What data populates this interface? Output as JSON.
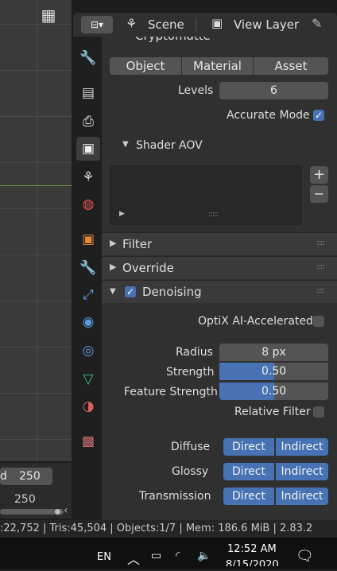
{
  "viewport": {
    "grid_icon": "grid-icon"
  },
  "timeline": {
    "frame_label": "d",
    "frame_value": "250",
    "ruler_value": "250"
  },
  "header": {
    "scene_label": "Scene",
    "view_layer_label": "View Layer"
  },
  "cryptomatte": {
    "title": "Cryptomatte",
    "buttons": [
      "Object",
      "Material",
      "Asset"
    ],
    "levels_label": "Levels",
    "levels_value": "6",
    "accurate_label": "Accurate Mode",
    "accurate_checked": true
  },
  "shader_aov": {
    "title": "Shader AOV",
    "add": "+",
    "remove": "−"
  },
  "panels": {
    "filter": "Filter",
    "override": "Override",
    "denoising": "Denoising"
  },
  "denoising": {
    "enabled": true,
    "optix_label": "OptiX AI-Accelerated",
    "radius_label": "Radius",
    "radius_value": "8 px",
    "strength_label": "Strength",
    "strength_value": "0.50",
    "strength_fraction": 0.5,
    "feature_label": "Feature Strength",
    "feature_value": "0.50",
    "feature_fraction": 0.5,
    "relative_label": "Relative Filter",
    "rows": [
      {
        "label": "Diffuse",
        "direct": "Direct",
        "indirect": "Indirect"
      },
      {
        "label": "Glossy",
        "direct": "Direct",
        "indirect": "Indirect"
      },
      {
        "label": "Transmission",
        "direct": "Direct",
        "indirect": "Indirect"
      }
    ]
  },
  "status": {
    "text": ":22,752 | Tris:45,504 | Objects:1/7 | Mem: 186.6 MiB | 2.83.2"
  },
  "taskbar": {
    "lang": "EN",
    "time": "12:52 AM",
    "date": "8/15/2020"
  },
  "colors": {
    "accent": "#4772b3",
    "panel": "#303030"
  }
}
